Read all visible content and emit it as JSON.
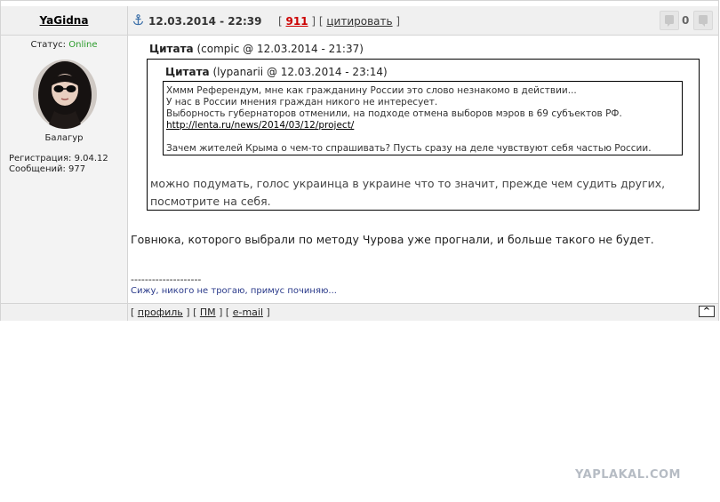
{
  "author": {
    "username": "YaGidna",
    "status_label": "Статус:",
    "status_value": "Online",
    "rank": "Балагур",
    "registration": "Регистрация: 9.04.12",
    "messages": "Сообщений: 977"
  },
  "header": {
    "date": "12.03.2014 - 22:39",
    "post_number": "911",
    "cite_label": "цитировать",
    "rating_count": "0"
  },
  "quote_outer": {
    "title": "Цитата",
    "meta": "(compic @ 12.03.2014 - 21:37)",
    "reply": "можно подумать, голос украинца в украине что то значит, прежде чем судить других, посмотрите на себя."
  },
  "quote_inner": {
    "title": "Цитата",
    "meta": "(lypanarii @ 12.03.2014 - 23:14)",
    "lines": [
      "Хммм Референдум, мне как гражданину России это слово незнакомо в действии...",
      "У нас в России мнения граждан никого не интересует.",
      "Выборность губернаторов отменили, на подходе отмена выборов мэров в 69 субъектов РФ."
    ],
    "link": "http://lenta.ru/news/2014/03/12/project/",
    "last_line": "Зачем жителей Крыма о чем-то спрашивать? Пусть сразу на деле чувствуют себя частью России."
  },
  "message": "Говнюка, которого выбрали по методу Чурова уже прогнали, и больше такого не будет.",
  "signature": {
    "separator": "--------------------",
    "text": "Сижу, никого не трогаю, примус починяю..."
  },
  "footer": {
    "profile": "профиль",
    "pm": "ПМ",
    "email": "e-mail",
    "to_top": "^"
  },
  "watermark": "YAPLAKAL.COM",
  "colors": {
    "online": "#2a9b2a",
    "post_number": "#cc0000",
    "signature": "#2a3a8a"
  }
}
